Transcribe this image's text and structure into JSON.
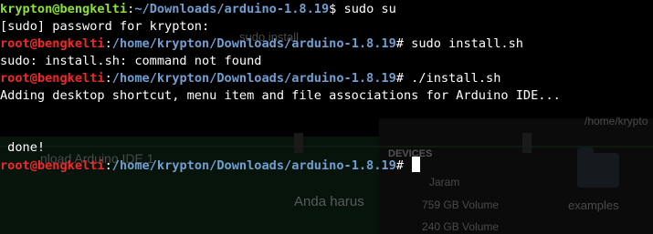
{
  "background_window": {
    "top_text": "sudo install",
    "window_title": "nload Arduino IDE 1",
    "body_text": "Anda harus",
    "sidebar_header": "DEVICES",
    "devices": [
      "Jaram",
      "759 GB Volume",
      "240 GB Volume"
    ],
    "location": "/home/krypto",
    "folder_label": "examples"
  },
  "terminal": {
    "lines": [
      {
        "type": "prompt",
        "user": "krypton",
        "at": "@",
        "host": "bengkelti",
        "colon": ":",
        "path": "~/Downloads/arduino-1.8.19",
        "symbol": "$ ",
        "command": "sudo su"
      },
      {
        "type": "output",
        "text": "[sudo] password for krypton:"
      },
      {
        "type": "prompt",
        "user": "root",
        "at": "@",
        "host": "bengkelti",
        "colon": ":",
        "path": "/home/krypton/Downloads/arduino-1.8.19",
        "symbol": "# ",
        "command": "sudo install.sh"
      },
      {
        "type": "output",
        "text": "sudo: install.sh: command not found"
      },
      {
        "type": "prompt",
        "user": "root",
        "at": "@",
        "host": "bengkelti",
        "colon": ":",
        "path": "/home/krypton/Downloads/arduino-1.8.19",
        "symbol": "# ",
        "command": "./install.sh"
      },
      {
        "type": "output",
        "text": "Adding desktop shortcut, menu item and file associations for Arduino IDE..."
      },
      {
        "type": "output",
        "text": ""
      },
      {
        "type": "output",
        "text": ""
      },
      {
        "type": "output",
        "text": " done!"
      },
      {
        "type": "prompt",
        "user": "root",
        "at": "@",
        "host": "bengkelti",
        "colon": ":",
        "path": "/home/krypton/Downloads/arduino-1.8.19",
        "symbol": "# ",
        "command": ""
      }
    ]
  },
  "colors": {
    "terminal_background": "#000000",
    "user_normal": "#8ae234",
    "user_root": "#ef2929",
    "path": "#729fcf",
    "text": "#ffffff",
    "cursor": "#ffffff"
  }
}
